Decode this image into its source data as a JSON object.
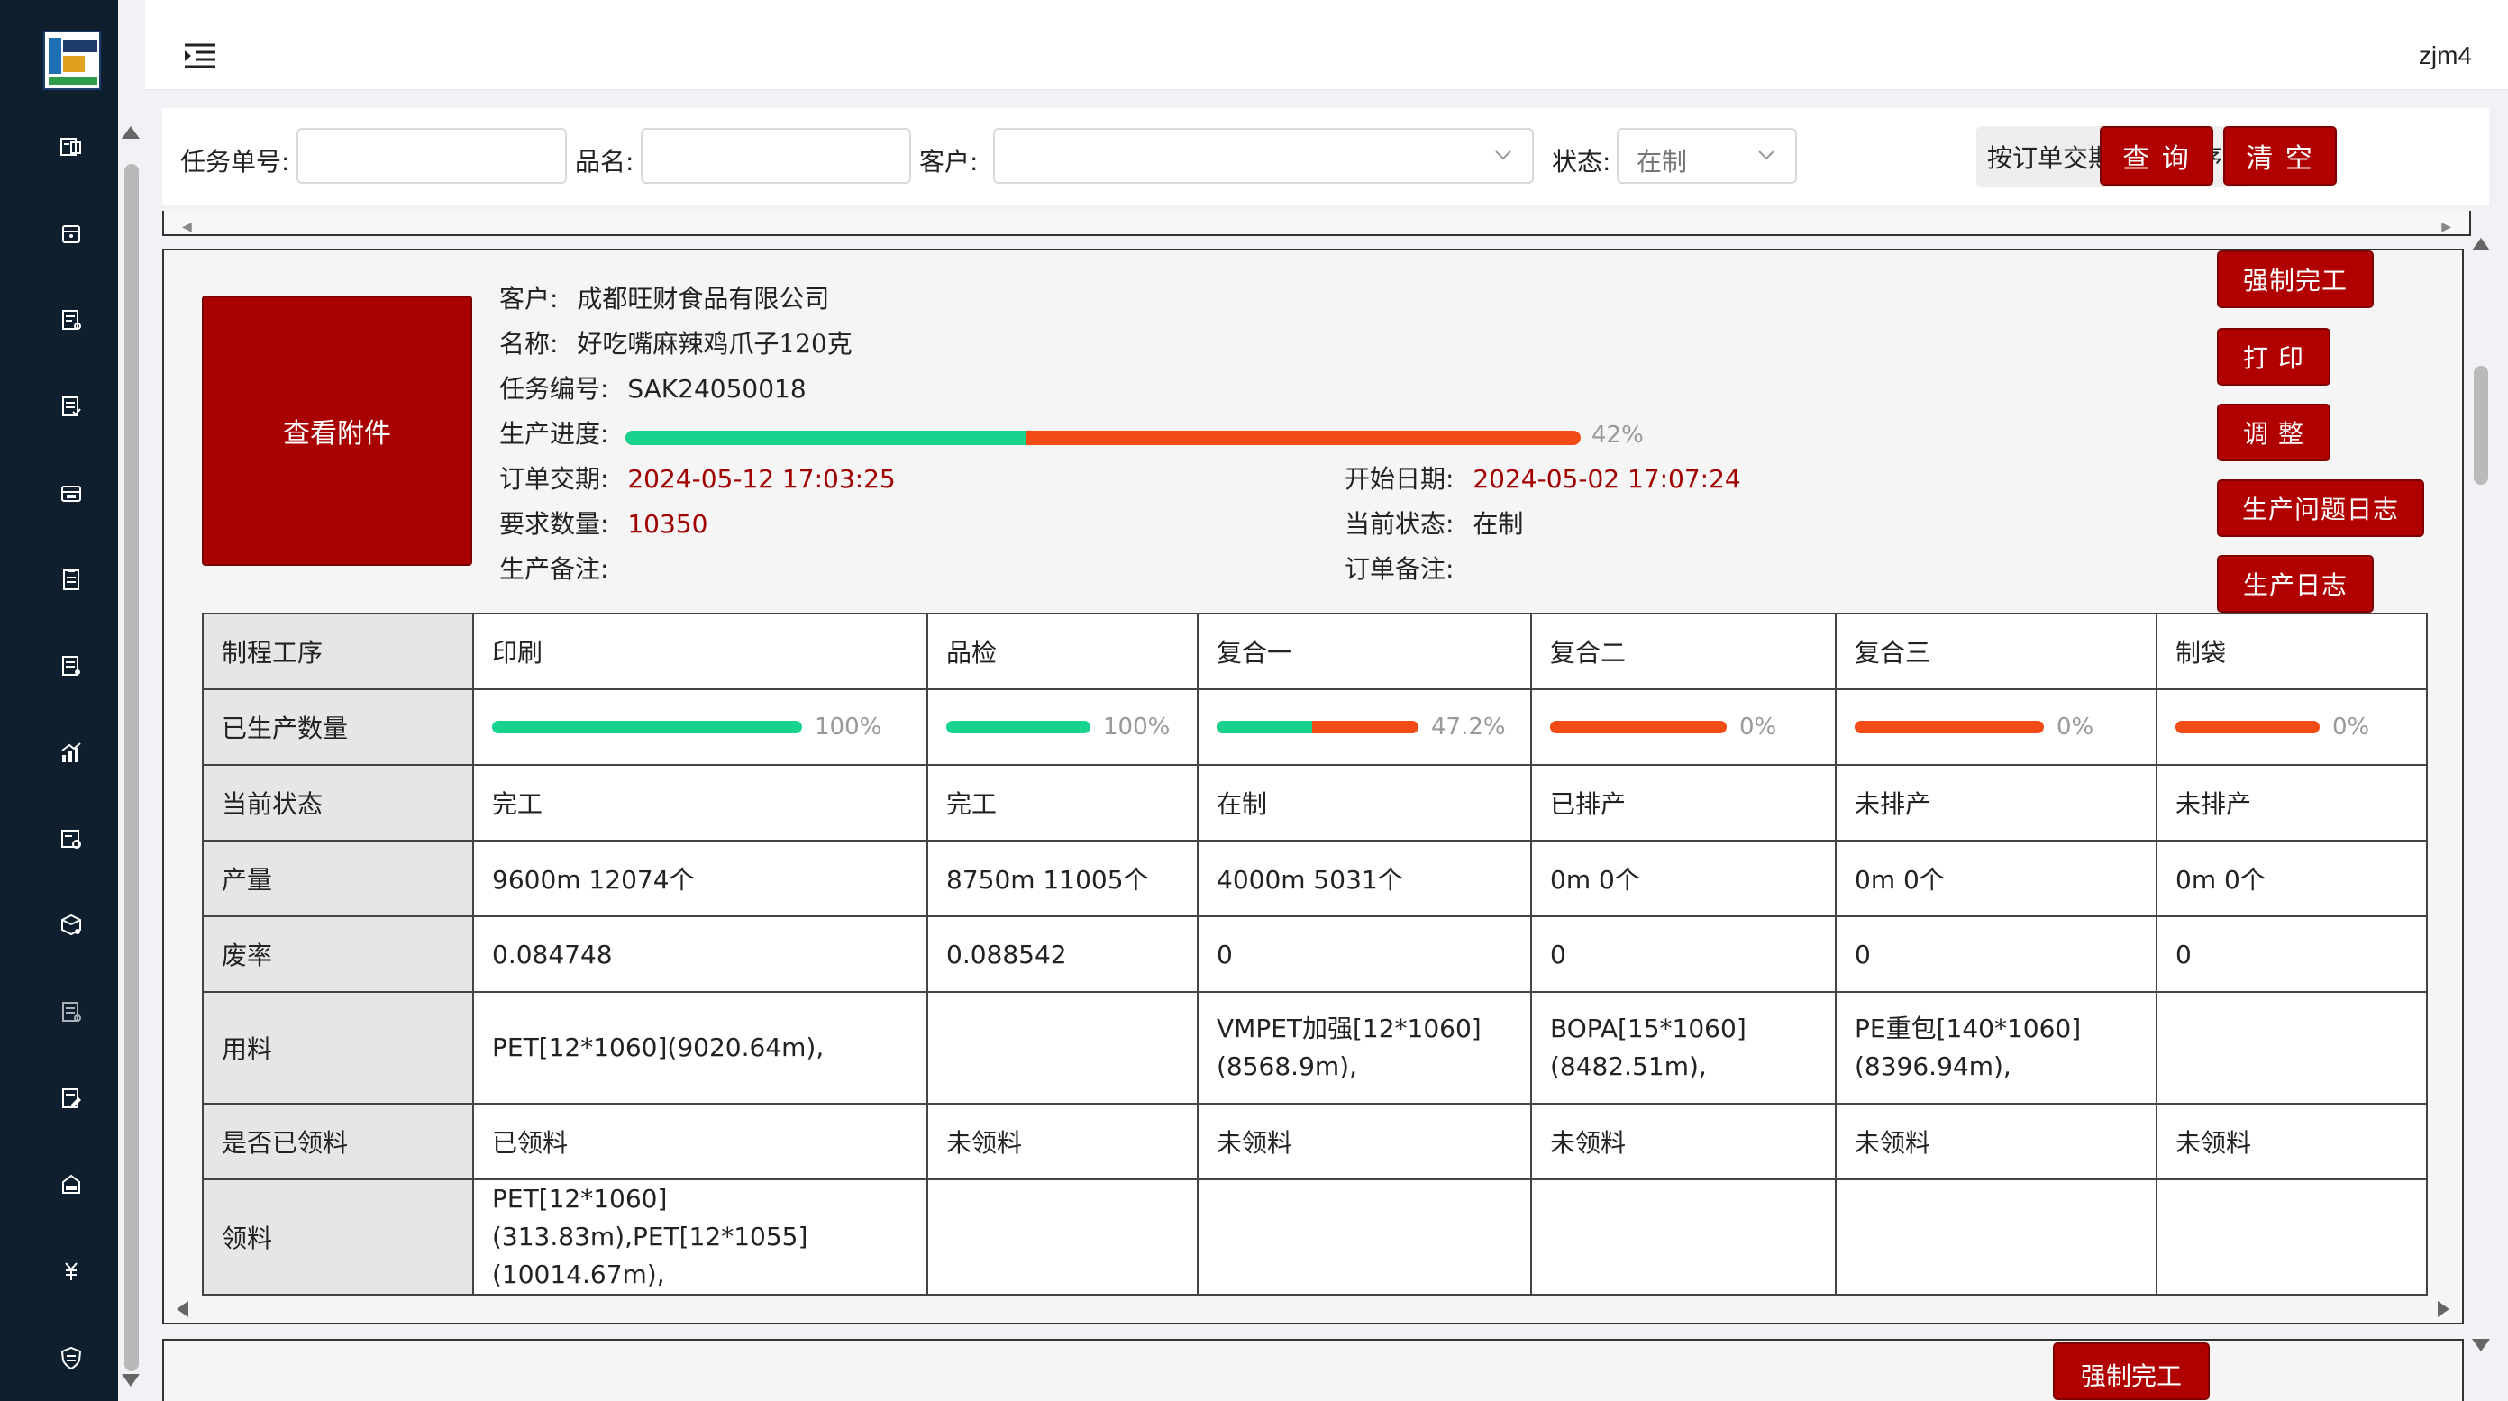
{
  "header": {
    "username": "zjm4"
  },
  "sidebar": {
    "icons": [
      "dashboard-icon",
      "inventory-icon",
      "order-icon",
      "task-icon",
      "warehouse-icon",
      "document-icon",
      "report-icon",
      "chart-icon",
      "schedule-icon",
      "package-icon",
      "record-icon",
      "edit-icon",
      "sale-icon",
      "finance-icon",
      "quality-icon"
    ]
  },
  "filter": {
    "task_no_label": "任务单号:",
    "task_no_value": "",
    "product_label": "品名:",
    "product_value": "",
    "customer_label": "客户:",
    "customer_value": "",
    "status_label": "状态:",
    "status_value": "在制",
    "sort_label": "按订单交期排序:降序",
    "query_label": "查 询",
    "clear_label": "清 空"
  },
  "card": {
    "attach_label": "查看附件",
    "customer_label": "客户:",
    "customer": "成都旺财食品有限公司",
    "name_label": "名称:",
    "name": "好吃嘴麻辣鸡爪子120克",
    "task_label": "任务编号:",
    "task_no": "SAK24050018",
    "progress_label": "生产进度:",
    "progress": 42,
    "progress_text": "42%",
    "due_label": "订单交期:",
    "due": "2024-05-12 17:03:25",
    "start_label": "开始日期:",
    "start": "2024-05-02 17:07:24",
    "qty_label": "要求数量:",
    "qty": "10350",
    "status_label": "当前状态:",
    "status": "在制",
    "prod_note_label": "生产备注:",
    "prod_note": "",
    "order_note_label": "订单备注:",
    "order_note": "",
    "buttons": {
      "force_complete": "强制完工",
      "print": "打 印",
      "adjust": "调 整",
      "issue_log": "生产问题日志",
      "prod_log": "生产日志"
    }
  },
  "table": {
    "row_headers": {
      "process": "制程工序",
      "produced": "已生产数量",
      "state": "当前状态",
      "output": "产量",
      "waste": "废率",
      "material": "用料",
      "picked": "是否已领料",
      "pick": "领料"
    },
    "columns": [
      {
        "process": "印刷",
        "pct": 100,
        "pct_text": "100%",
        "state": "完工",
        "output": "9600m 12074个",
        "waste": "0.084748",
        "material_1": "PET[12*1060](9020.64m),",
        "material_2": "",
        "picked": "已领料",
        "pick_1": "PET[12*1060](313.83m),PET[12*1055]",
        "pick_2": "(10014.67m),"
      },
      {
        "process": "品检",
        "pct": 100,
        "pct_text": "100%",
        "state": "完工",
        "output": "8750m 11005个",
        "waste": "0.088542",
        "material_1": "",
        "material_2": "",
        "picked": "未领料",
        "pick_1": "",
        "pick_2": ""
      },
      {
        "process": "复合一",
        "pct": 47.2,
        "pct_text": "47.2%",
        "state": "在制",
        "output": "4000m 5031个",
        "waste": "0",
        "material_1": "VMPET加强[12*1060]",
        "material_2": "(8568.9m),",
        "picked": "未领料",
        "pick_1": "",
        "pick_2": ""
      },
      {
        "process": "复合二",
        "pct": 0,
        "pct_text": "0%",
        "state": "已排产",
        "output": "0m 0个",
        "waste": "0",
        "material_1": "BOPA[15*1060]",
        "material_2": "(8482.51m),",
        "picked": "未领料",
        "pick_1": "",
        "pick_2": ""
      },
      {
        "process": "复合三",
        "pct": 0,
        "pct_text": "0%",
        "state": "未排产",
        "output": "0m 0个",
        "waste": "0",
        "material_1": "PE重包[140*1060]",
        "material_2": "(8396.94m),",
        "picked": "未领料",
        "pick_1": "",
        "pick_2": ""
      },
      {
        "process": "制袋",
        "pct": 0,
        "pct_text": "0%",
        "state": "未排产",
        "output": "0m 0个",
        "waste": "0",
        "material_1": "",
        "material_2": "",
        "picked": "未领料",
        "pick_1": "",
        "pick_2": ""
      }
    ]
  },
  "next_card": {
    "force_complete": "强制完工"
  },
  "colors": {
    "brand_red": "#b00000",
    "progress_green": "#18d38e",
    "progress_orange": "#f24b16",
    "sidebar_bg": "#0f1f2e"
  }
}
